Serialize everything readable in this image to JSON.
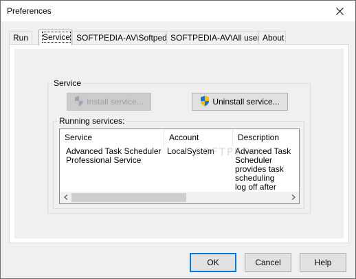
{
  "window": {
    "title": "Preferences"
  },
  "tabs": [
    {
      "label": "Run",
      "active": false
    },
    {
      "label": "Service",
      "active": true
    },
    {
      "label": "SOFTPEDIA-AV\\Softpedia",
      "active": false
    },
    {
      "label": "SOFTPEDIA-AV\\All users",
      "active": false
    },
    {
      "label": "About",
      "active": false
    }
  ],
  "service_group": {
    "label": "Service",
    "install_button": {
      "label": "Install service...",
      "enabled": false
    },
    "uninstall_button": {
      "label": "Uninstall service...",
      "enabled": true
    }
  },
  "running_services": {
    "label": "Running services:",
    "columns": [
      "Service",
      "Account",
      "Description"
    ],
    "rows": [
      {
        "service": "Advanced Task Scheduler\nProfessional Service",
        "account": "LocalSystem",
        "description": "Advanced Task Scheduler\nprovides task scheduling\nlog off after setting\nhave to be logged on"
      }
    ]
  },
  "watermark": "SOFTPEDIA",
  "buttons": {
    "ok": "OK",
    "cancel": "Cancel",
    "help": "Help"
  },
  "colors": {
    "window_bg": "#f0f0f0",
    "button_bg": "#e1e1e1",
    "default_button_border": "#0078d7",
    "shield_blue": "#1c6fd0",
    "shield_yellow": "#f5c400"
  },
  "icons": {
    "close": "close-icon",
    "uac_shield": "uac-shield-icon",
    "scroll_left": "scroll-left-icon",
    "scroll_right": "scroll-right-icon"
  }
}
